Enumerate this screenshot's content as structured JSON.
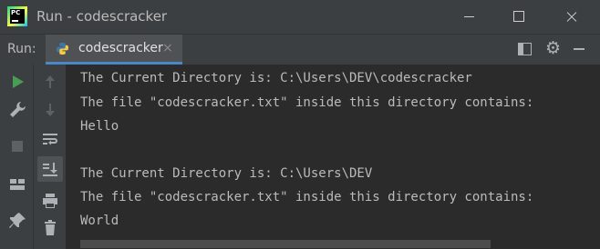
{
  "window": {
    "title": "Run - codescracker",
    "logo_text": "PC"
  },
  "run_panel": {
    "label": "Run:",
    "tab_label": "codescracker",
    "tab_close": "×"
  },
  "console": {
    "lines": [
      "The Current Directory is: C:\\Users\\DEV\\codescracker",
      "The file \"codescracker.txt\" inside this directory contains:",
      "Hello",
      "",
      "The Current Directory is: C:\\Users\\DEV",
      "The file \"codescracker.txt\" inside this directory contains:",
      "World"
    ]
  },
  "icons": {
    "toolbar_left": [
      "run-icon",
      "wrench-icon",
      "stop-icon",
      "layout-icon",
      "pin-icon"
    ],
    "toolbar_right": [
      "arrow-up-icon",
      "arrow-down-icon",
      "soft-wrap-icon",
      "scroll-to-end-icon",
      "print-icon",
      "trash-icon"
    ],
    "header": [
      "python-file-icon",
      "panel-layout-icon",
      "gear-icon",
      "minimize-panel-icon"
    ]
  },
  "colors": {
    "background": "#2b2b2b",
    "chrome": "#3c3f41",
    "text": "#bbbbbb",
    "run_green": "#499c54",
    "tab_underline": "#4a88c7"
  }
}
